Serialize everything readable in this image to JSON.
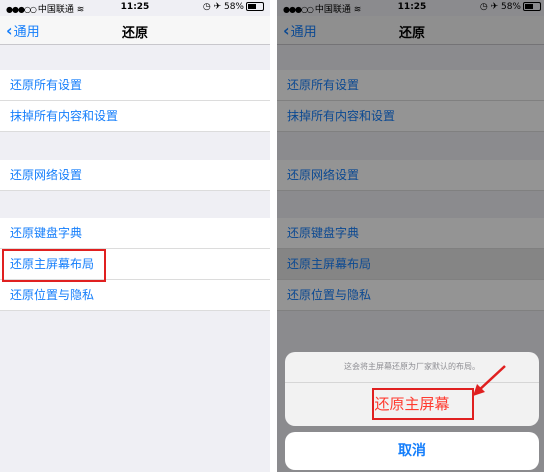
{
  "statusbar": {
    "carrier": "中国联通",
    "time": "11:25",
    "battery": "58%"
  },
  "navbar": {
    "back_label": "通用",
    "title": "还原"
  },
  "settings": {
    "reset_all": "还原所有设置",
    "erase_all": "抹掉所有内容和设置",
    "reset_network": "还原网络设置",
    "reset_keyboard": "还原键盘字典",
    "reset_home_screen": "还原主屏幕布局",
    "reset_location_privacy": "还原位置与隐私"
  },
  "action_sheet": {
    "message": "这会将主屏幕还原为厂家默认的布局。",
    "confirm_label": "还原主屏幕",
    "cancel_label": "取消"
  },
  "colors": {
    "ios_blue": "#147efb",
    "destructive_red": "#ff3b30",
    "annotation_red": "#e02020"
  }
}
